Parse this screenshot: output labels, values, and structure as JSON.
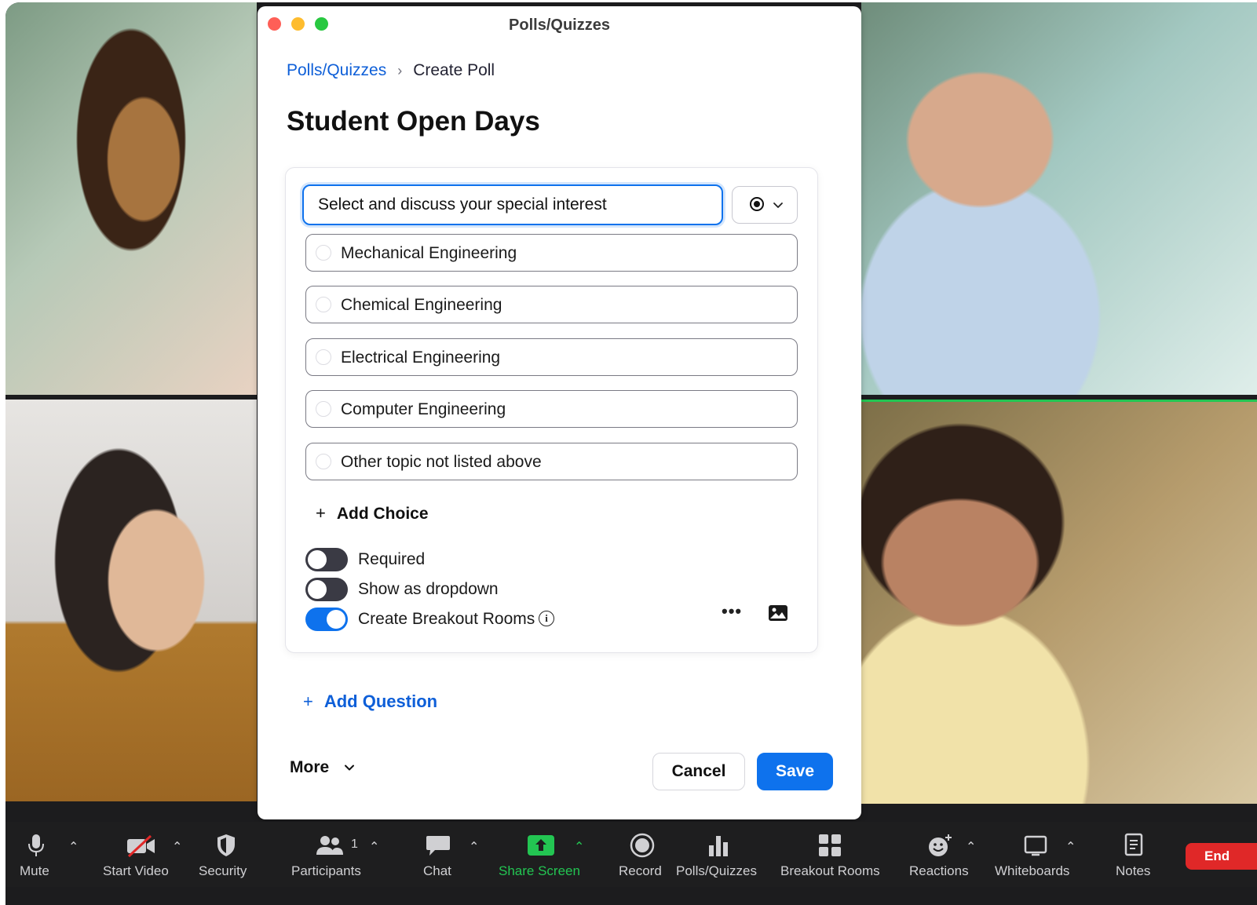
{
  "window": {
    "title": "Polls/Quizzes"
  },
  "breadcrumb": {
    "parent": "Polls/Quizzes",
    "current": "Create Poll"
  },
  "poll": {
    "title": "Student Open Days",
    "question": "Select and discuss your special interest",
    "choices": [
      "Mechanical Engineering",
      "Chemical Engineering",
      "Electrical Engineering",
      "Computer Engineering",
      "Other topic not listed above"
    ],
    "add_choice_label": "Add Choice",
    "options": {
      "required": {
        "label": "Required",
        "on": false
      },
      "dropdown": {
        "label": "Show as dropdown",
        "on": false
      },
      "breakout": {
        "label": "Create Breakout Rooms",
        "on": true
      }
    },
    "add_question_label": "Add Question"
  },
  "footer": {
    "more_label": "More",
    "cancel_label": "Cancel",
    "save_label": "Save"
  },
  "toolbar": {
    "mute": "Mute",
    "start_video": "Start Video",
    "security": "Security",
    "participants": "Participants",
    "participants_count": "1",
    "chat": "Chat",
    "share_screen": "Share Screen",
    "record": "Record",
    "polls": "Polls/Quizzes",
    "breakout_rooms": "Breakout Rooms",
    "reactions": "Reactions",
    "whiteboards": "Whiteboards",
    "notes": "Notes",
    "end": "End"
  },
  "colors": {
    "accent": "#0e72ed",
    "link": "#0e5fd8",
    "share_green": "#23c552",
    "end_red": "#e02828"
  }
}
